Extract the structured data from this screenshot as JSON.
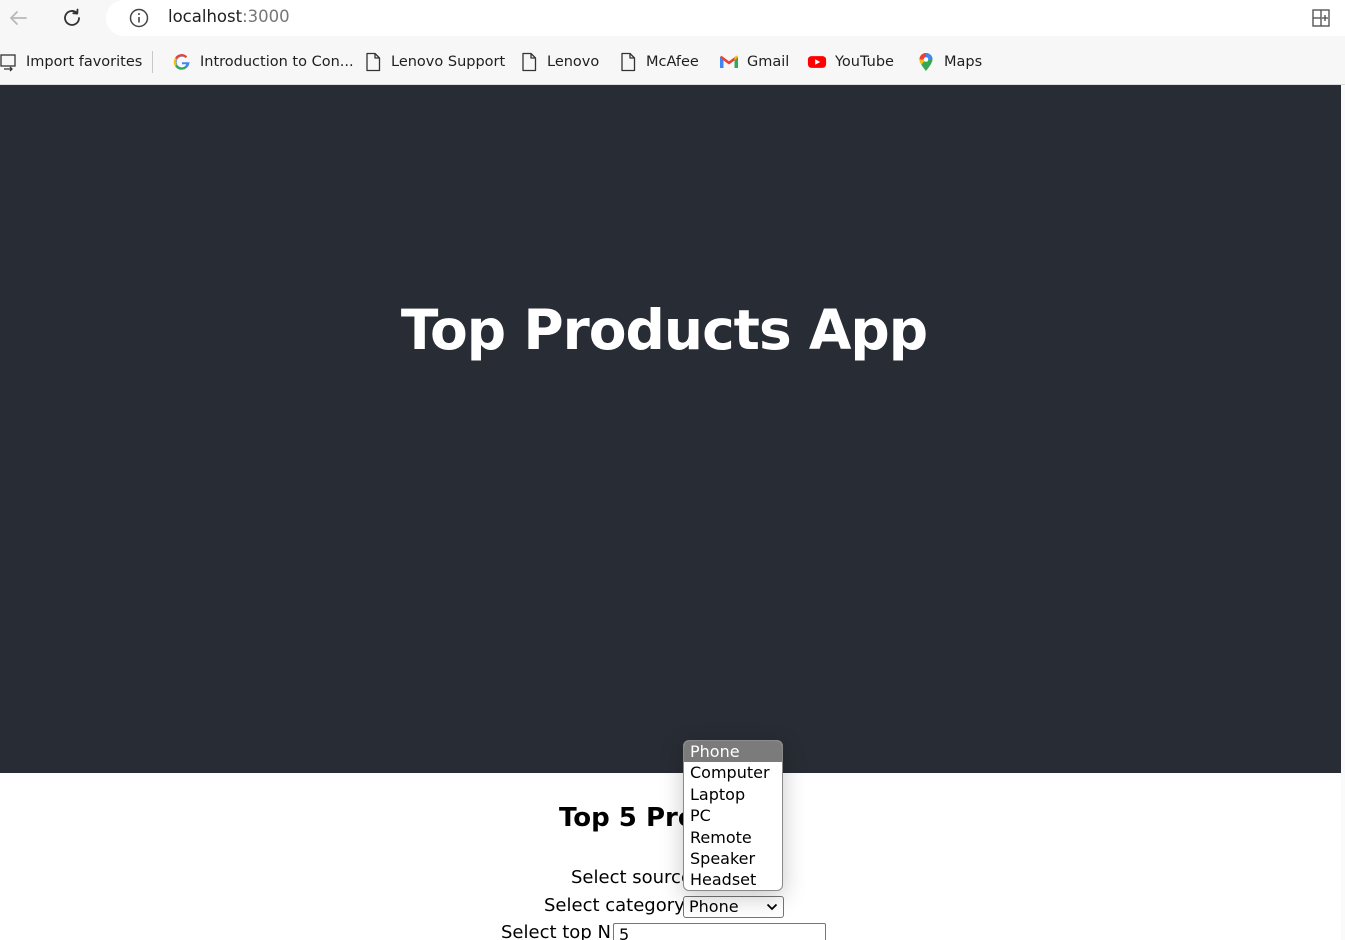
{
  "browser": {
    "url_host": "localhost",
    "url_port": ":3000",
    "icons": [
      "back-arrow-icon",
      "reload-icon",
      "info-icon",
      "split-screen-icon"
    ]
  },
  "favorites": [
    {
      "label": "Import favorites",
      "icon": "import-favorites-icon"
    },
    {
      "label": "Introduction to Con...",
      "icon": "google-icon"
    },
    {
      "label": "Lenovo Support",
      "icon": "page-icon"
    },
    {
      "label": "Lenovo",
      "icon": "page-icon"
    },
    {
      "label": "McAfee",
      "icon": "page-icon"
    },
    {
      "label": "Gmail",
      "icon": "gmail-icon"
    },
    {
      "label": "YouTube",
      "icon": "youtube-icon"
    },
    {
      "label": "Maps",
      "icon": "maps-icon"
    }
  ],
  "app": {
    "title": "Top Products App",
    "subtitle": "Top 5 Pro",
    "source_label": "Select source",
    "category_label": "Select category:",
    "category_value": "Phone",
    "topn_label": "Select top N:",
    "topn_value": "5"
  },
  "dropdown": {
    "options": [
      "Phone",
      "Computer",
      "Laptop",
      "PC",
      "Remote",
      "Speaker",
      "Headset"
    ],
    "selected": "Phone"
  },
  "colors": {
    "header_bg": "#282c34",
    "title_text": "#ffffff",
    "selected_option_bg": "#7b7b7b"
  }
}
